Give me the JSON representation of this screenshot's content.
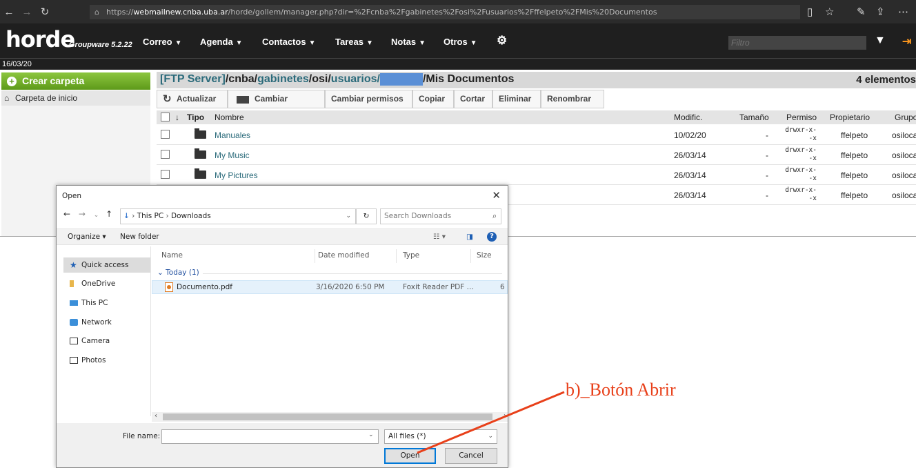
{
  "browser": {
    "url_prefix": "https://",
    "url_domain": "webmailnew.cnba.uba.ar",
    "url_path": "/horde/gollem/manager.php?dir=%2Fcnba%2Fgabinetes%2Fosi%2Fusuarios%2Fffelpeto%2FMis%20Documentos"
  },
  "app": {
    "logo": "horde",
    "version": "Groupware 5.2.22",
    "date": "16/03/20",
    "menu": [
      "Correo",
      "Agenda",
      "Contactos",
      "Tareas",
      "Notas",
      "Otros"
    ],
    "filter_placeholder": "Filtro"
  },
  "sidebar": {
    "create_folder": "Crear carpeta",
    "home_folder": "Carpeta de inicio"
  },
  "path": {
    "server": "[FTP Server]",
    "seg1": "/cnba/",
    "seg2": "gabinetes",
    "seg3": "/osi/",
    "seg4": "usuarios/",
    "last": "/Mis Documentos",
    "count": "4 elementos"
  },
  "toolbar": [
    "Actualizar",
    "Cambiar carpeta",
    "Cambiar permisos",
    "Copiar",
    "Cortar",
    "Eliminar",
    "Renombrar"
  ],
  "table": {
    "headers": {
      "type": "Tipo",
      "name": "Nombre",
      "modified": "Modific.",
      "size": "Tamaño",
      "perm": "Permiso",
      "owner": "Propietario",
      "group": "Grupo"
    },
    "rows": [
      {
        "name": "Manuales",
        "date": "10/02/20",
        "size": "-",
        "perm1": "drwxr-x-",
        "perm2": "-x",
        "owner": "ffelpeto",
        "group": "osilocal"
      },
      {
        "name": "My Music",
        "date": "26/03/14",
        "size": "-",
        "perm1": "drwxr-x-",
        "perm2": "-x",
        "owner": "ffelpeto",
        "group": "osilocal"
      },
      {
        "name": "My Pictures",
        "date": "26/03/14",
        "size": "-",
        "perm1": "drwxr-x-",
        "perm2": "-x",
        "owner": "ffelpeto",
        "group": "osilocal"
      },
      {
        "name": "",
        "date": "26/03/14",
        "size": "-",
        "perm1": "drwxr-x-",
        "perm2": "-x",
        "owner": "ffelpeto",
        "group": "osilocal"
      }
    ]
  },
  "dialog": {
    "title": "Open",
    "address": [
      "This PC",
      "Downloads"
    ],
    "search_placeholder": "Search Downloads",
    "organize": "Organize",
    "new_folder": "New folder",
    "nav": [
      "Quick access",
      "OneDrive",
      "This PC",
      "Network",
      "Camera",
      "Photos"
    ],
    "columns": {
      "name": "Name",
      "date": "Date modified",
      "type": "Type",
      "size": "Size"
    },
    "group": "Today (1)",
    "file": {
      "name": "Documento.pdf",
      "date": "3/16/2020 6:50 PM",
      "type": "Foxit Reader PDF ...",
      "size": "6"
    },
    "file_name_label": "File name:",
    "file_name_value": "",
    "file_type": "All files (*)",
    "open": "Open",
    "cancel": "Cancel"
  },
  "annotation": "b)_Botón Abrir",
  "colors": {
    "accent": "#0078d7",
    "annotation": "#e8401a",
    "sidebar_green": "#6aa823"
  }
}
